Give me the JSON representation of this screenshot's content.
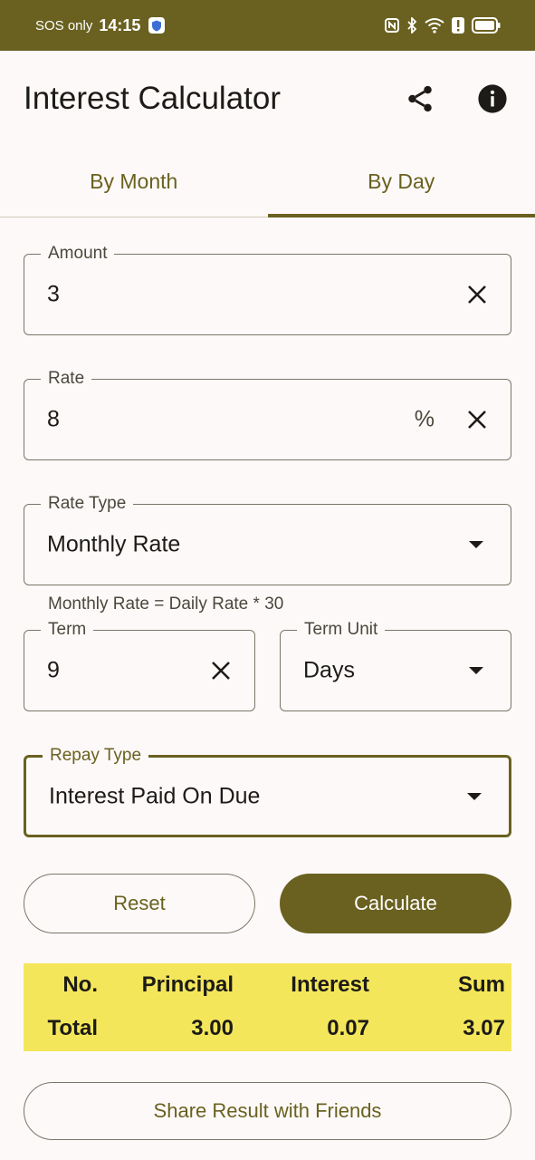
{
  "status_bar": {
    "carrier": "SOS only",
    "time": "14:15",
    "icons": [
      "nfc-icon",
      "bluetooth-icon",
      "wifi-icon",
      "alert-icon",
      "battery-icon"
    ]
  },
  "app_bar": {
    "title": "Interest Calculator",
    "actions": [
      "share-icon",
      "info-icon"
    ]
  },
  "tabs": [
    {
      "label": "By Month",
      "active": false
    },
    {
      "label": "By Day",
      "active": true
    }
  ],
  "form": {
    "amount": {
      "label": "Amount",
      "value": "3"
    },
    "rate": {
      "label": "Rate",
      "value": "8",
      "suffix": "%"
    },
    "rate_type": {
      "label": "Rate Type",
      "value": "Monthly Rate",
      "helper": "Monthly Rate = Daily Rate * 30"
    },
    "term": {
      "label": "Term",
      "value": "9"
    },
    "term_unit": {
      "label": "Term Unit",
      "value": "Days"
    },
    "repay_type": {
      "label": "Repay Type",
      "value": "Interest Paid On Due"
    }
  },
  "buttons": {
    "reset": "Reset",
    "calculate": "Calculate",
    "share": "Share Result with Friends"
  },
  "result_table": {
    "headers": [
      "No.",
      "Principal",
      "Interest",
      "Sum"
    ],
    "rows": [
      [
        "Total",
        "3.00",
        "0.07",
        "3.07"
      ]
    ]
  },
  "colors": {
    "primary": "#6a6120",
    "result_background": "#f4e65a",
    "background": "#fdf9f8"
  }
}
